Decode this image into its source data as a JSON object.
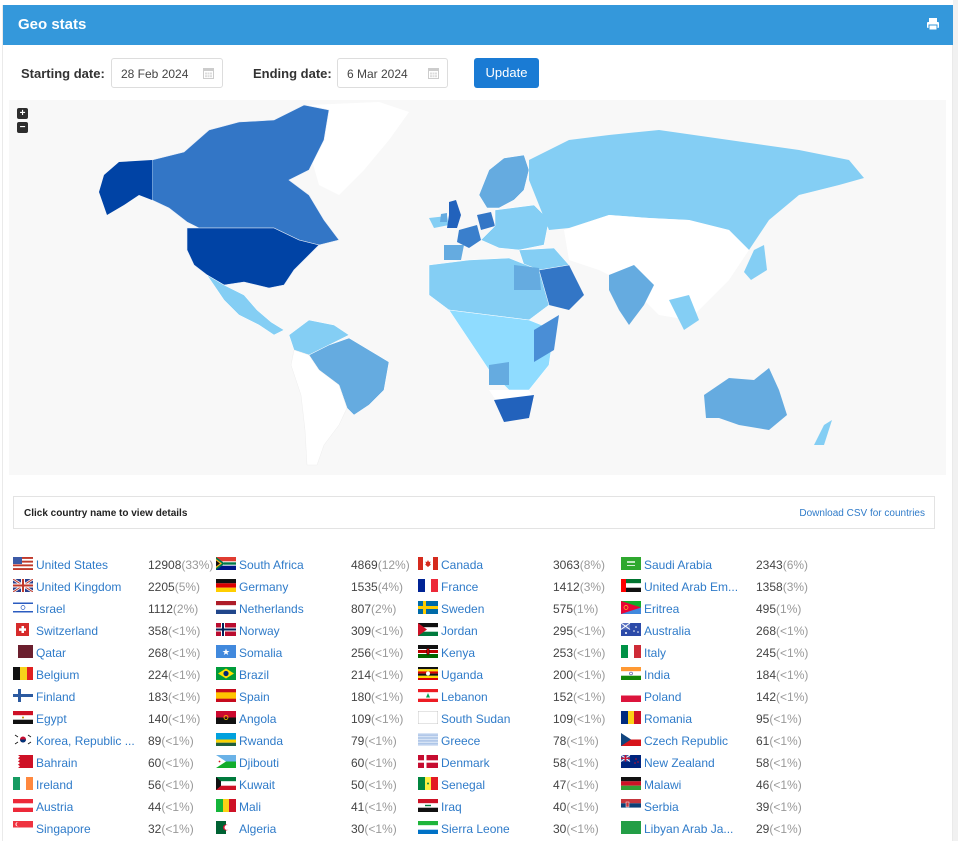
{
  "header": {
    "title": "Geo stats",
    "print_icon": "printer-icon"
  },
  "filters": {
    "start_label": "Starting date:",
    "start_value": "28 Feb 2024",
    "end_label": "Ending date:",
    "end_value": "6 Mar 2024",
    "calendar_icon": "calendar-icon",
    "update_label": "Update"
  },
  "map": {
    "zoom_in": "+",
    "zoom_out": "−",
    "colors": {
      "background": "#f8f8f8",
      "no_data": "#ffffff",
      "level_1": "#8fdcff",
      "level_2": "#84cef4",
      "level_3": "#65abe0",
      "level_4": "#4a8ed6",
      "level_5": "#3376c6",
      "level_6": "#2262bc",
      "level_7": "#0043a5"
    }
  },
  "info_bar": {
    "hint": "Click country name to view details",
    "download": "Download CSV for countries"
  },
  "columns": [
    [
      {
        "name": "United States",
        "count": "12908",
        "pct": "(33%)",
        "flag": "us"
      },
      {
        "name": "United Kingdom",
        "count": "2205",
        "pct": "(5%)",
        "flag": "gb"
      },
      {
        "name": "Israel",
        "count": "1112",
        "pct": "(2%)",
        "flag": "il"
      },
      {
        "name": "Switzerland",
        "count": "358",
        "pct": "(<1%)",
        "flag": "ch"
      },
      {
        "name": "Qatar",
        "count": "268",
        "pct": "(<1%)",
        "flag": "qa"
      },
      {
        "name": "Belgium",
        "count": "224",
        "pct": "(<1%)",
        "flag": "be"
      },
      {
        "name": "Finland",
        "count": "183",
        "pct": "(<1%)",
        "flag": "fi"
      },
      {
        "name": "Egypt",
        "count": "140",
        "pct": "(<1%)",
        "flag": "eg"
      },
      {
        "name": "Korea, Republic ...",
        "count": "89",
        "pct": "(<1%)",
        "flag": "kr"
      },
      {
        "name": "Bahrain",
        "count": "60",
        "pct": "(<1%)",
        "flag": "bh"
      },
      {
        "name": "Ireland",
        "count": "56",
        "pct": "(<1%)",
        "flag": "ie"
      },
      {
        "name": "Austria",
        "count": "44",
        "pct": "(<1%)",
        "flag": "at"
      },
      {
        "name": "Singapore",
        "count": "32",
        "pct": "(<1%)",
        "flag": "sg"
      }
    ],
    [
      {
        "name": "South Africa",
        "count": "4869",
        "pct": "(12%)",
        "flag": "za"
      },
      {
        "name": "Germany",
        "count": "1535",
        "pct": "(4%)",
        "flag": "de"
      },
      {
        "name": "Netherlands",
        "count": "807",
        "pct": "(2%)",
        "flag": "nl"
      },
      {
        "name": "Norway",
        "count": "309",
        "pct": "(<1%)",
        "flag": "no"
      },
      {
        "name": "Somalia",
        "count": "256",
        "pct": "(<1%)",
        "flag": "so"
      },
      {
        "name": "Brazil",
        "count": "214",
        "pct": "(<1%)",
        "flag": "br"
      },
      {
        "name": "Spain",
        "count": "180",
        "pct": "(<1%)",
        "flag": "es"
      },
      {
        "name": "Angola",
        "count": "109",
        "pct": "(<1%)",
        "flag": "ao"
      },
      {
        "name": "Rwanda",
        "count": "79",
        "pct": "(<1%)",
        "flag": "rw"
      },
      {
        "name": "Djibouti",
        "count": "60",
        "pct": "(<1%)",
        "flag": "dj"
      },
      {
        "name": "Kuwait",
        "count": "50",
        "pct": "(<1%)",
        "flag": "kw"
      },
      {
        "name": "Mali",
        "count": "41",
        "pct": "(<1%)",
        "flag": "ml"
      },
      {
        "name": "Algeria",
        "count": "30",
        "pct": "(<1%)",
        "flag": "dz"
      }
    ],
    [
      {
        "name": "Canada",
        "count": "3063",
        "pct": "(8%)",
        "flag": "ca"
      },
      {
        "name": "France",
        "count": "1412",
        "pct": "(3%)",
        "flag": "fr"
      },
      {
        "name": "Sweden",
        "count": "575",
        "pct": "(1%)",
        "flag": "se"
      },
      {
        "name": "Jordan",
        "count": "295",
        "pct": "(<1%)",
        "flag": "jo"
      },
      {
        "name": "Kenya",
        "count": "253",
        "pct": "(<1%)",
        "flag": "ke"
      },
      {
        "name": "Uganda",
        "count": "200",
        "pct": "(<1%)",
        "flag": "ug"
      },
      {
        "name": "Lebanon",
        "count": "152",
        "pct": "(<1%)",
        "flag": "lb"
      },
      {
        "name": "South Sudan",
        "count": "109",
        "pct": "(<1%)",
        "flag": "ss"
      },
      {
        "name": "Greece",
        "count": "78",
        "pct": "(<1%)",
        "flag": "gr"
      },
      {
        "name": "Denmark",
        "count": "58",
        "pct": "(<1%)",
        "flag": "dk"
      },
      {
        "name": "Senegal",
        "count": "47",
        "pct": "(<1%)",
        "flag": "sn"
      },
      {
        "name": "Iraq",
        "count": "40",
        "pct": "(<1%)",
        "flag": "iq"
      },
      {
        "name": "Sierra Leone",
        "count": "30",
        "pct": "(<1%)",
        "flag": "sl"
      }
    ],
    [
      {
        "name": "Saudi Arabia",
        "count": "2343",
        "pct": "(6%)",
        "flag": "sa"
      },
      {
        "name": "United Arab Em...",
        "count": "1358",
        "pct": "(3%)",
        "flag": "ae"
      },
      {
        "name": "Eritrea",
        "count": "495",
        "pct": "(1%)",
        "flag": "er"
      },
      {
        "name": "Australia",
        "count": "268",
        "pct": "(<1%)",
        "flag": "au"
      },
      {
        "name": "Italy",
        "count": "245",
        "pct": "(<1%)",
        "flag": "it"
      },
      {
        "name": "India",
        "count": "184",
        "pct": "(<1%)",
        "flag": "in"
      },
      {
        "name": "Poland",
        "count": "142",
        "pct": "(<1%)",
        "flag": "pl"
      },
      {
        "name": "Romania",
        "count": "95",
        "pct": "(<1%)",
        "flag": "ro"
      },
      {
        "name": "Czech Republic",
        "count": "61",
        "pct": "(<1%)",
        "flag": "cz"
      },
      {
        "name": "New Zealand",
        "count": "58",
        "pct": "(<1%)",
        "flag": "nz"
      },
      {
        "name": "Malawi",
        "count": "46",
        "pct": "(<1%)",
        "flag": "mw"
      },
      {
        "name": "Serbia",
        "count": "39",
        "pct": "(<1%)",
        "flag": "rs"
      },
      {
        "name": "Libyan Arab Ja...",
        "count": "29",
        "pct": "(<1%)",
        "flag": "ly"
      }
    ]
  ]
}
